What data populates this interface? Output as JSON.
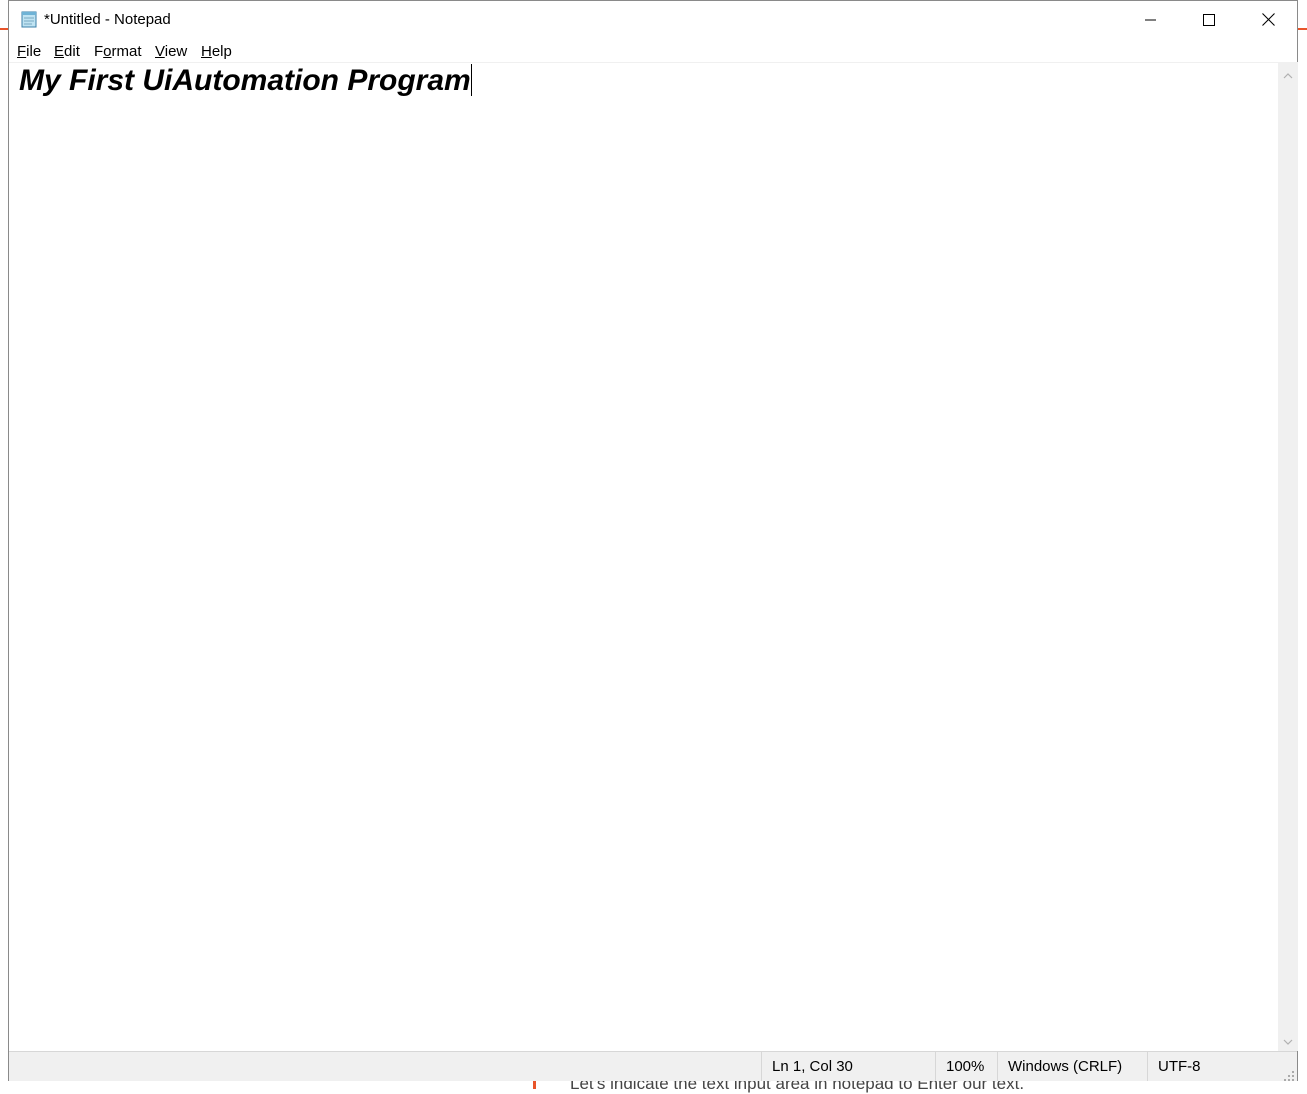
{
  "window": {
    "title": "*Untitled - Notepad"
  },
  "menu": {
    "file": {
      "mnemonic": "F",
      "rest": "ile"
    },
    "edit": {
      "mnemonic": "E",
      "rest": "dit"
    },
    "format": {
      "pre": "F",
      "mnemonic": "o",
      "rest": "rmat"
    },
    "view": {
      "mnemonic": "V",
      "rest": "iew"
    },
    "help": {
      "mnemonic": "H",
      "rest": "elp"
    }
  },
  "editor": {
    "text": "My First UiAutomation Program"
  },
  "status": {
    "position": "Ln 1, Col 30",
    "zoom": "100%",
    "line_ending": "Windows (CRLF)",
    "encoding": "UTF-8"
  },
  "background": {
    "bottom_text": "Let's indicate the text input area in notepad to Enter our text."
  },
  "icons": {
    "app": "notepad-icon",
    "minimize": "minimize-icon",
    "maximize": "maximize-icon",
    "close": "close-icon",
    "scroll_up": "chevron-up-icon",
    "scroll_down": "chevron-down-icon",
    "grip": "resize-grip-icon"
  },
  "colors": {
    "accent": "#e8542a",
    "statusbar": "#f0f0f0",
    "scrollbar": "#f0f0f0"
  }
}
